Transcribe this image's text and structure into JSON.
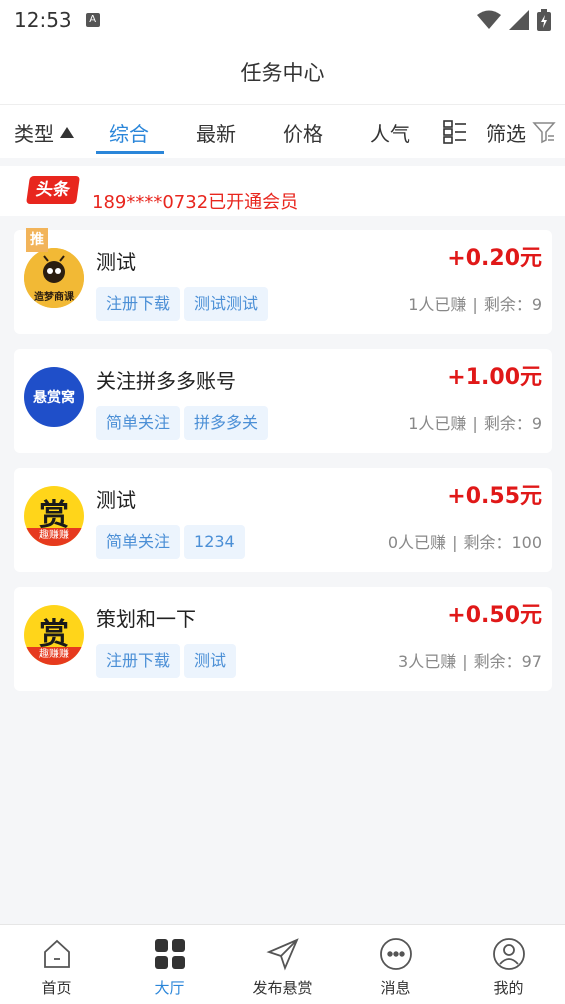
{
  "status_bar": {
    "time": "12:53",
    "a_badge": "A"
  },
  "header": {
    "title": "任务中心"
  },
  "filters": {
    "type_label": "类型",
    "tabs": [
      "综合",
      "最新",
      "价格",
      "人气"
    ],
    "active_tab": "综合",
    "filter_label": "筛选"
  },
  "notice": {
    "badge": "头条",
    "text": "189****0732已开通会员"
  },
  "tasks": [
    {
      "title": "测试",
      "reward": "+0.20元",
      "tags": [
        "注册下载",
        "测试测试"
      ],
      "earned": "1人已赚",
      "remaining": "剩余：9",
      "recommended": "推",
      "logo_text": "造梦商课",
      "logo_color": "#f2b935"
    },
    {
      "title": "关注拼多多账号",
      "reward": "+1.00元",
      "tags": [
        "简单关注",
        "拼多多关"
      ],
      "earned": "1人已赚",
      "remaining": "剩余：9",
      "logo_text": "悬赏窝",
      "logo_color": "#1f4fc9"
    },
    {
      "title": "测试",
      "reward": "+0.55元",
      "tags": [
        "简单关注",
        "1234"
      ],
      "earned": "0人已赚",
      "remaining": "剩余：100",
      "logo_text": "赏",
      "logo_sub": "趣赚赚",
      "logo_color": "#ffd51a"
    },
    {
      "title": "策划和一下",
      "reward": "+0.50元",
      "tags": [
        "注册下载",
        "测试"
      ],
      "earned": "3人已赚",
      "remaining": "剩余：97",
      "logo_text": "赏",
      "logo_sub": "趣赚赚",
      "logo_color": "#ffd51a"
    }
  ],
  "bottom_nav": [
    {
      "label": "首页",
      "icon": "home-icon"
    },
    {
      "label": "大厅",
      "icon": "grid-icon",
      "active": true
    },
    {
      "label": "发布悬赏",
      "icon": "send-icon"
    },
    {
      "label": "消息",
      "icon": "chat-icon"
    },
    {
      "label": "我的",
      "icon": "user-icon"
    }
  ],
  "colors": {
    "accent": "#2b86d9",
    "reward": "#e01818",
    "notice": "#e8261e"
  }
}
